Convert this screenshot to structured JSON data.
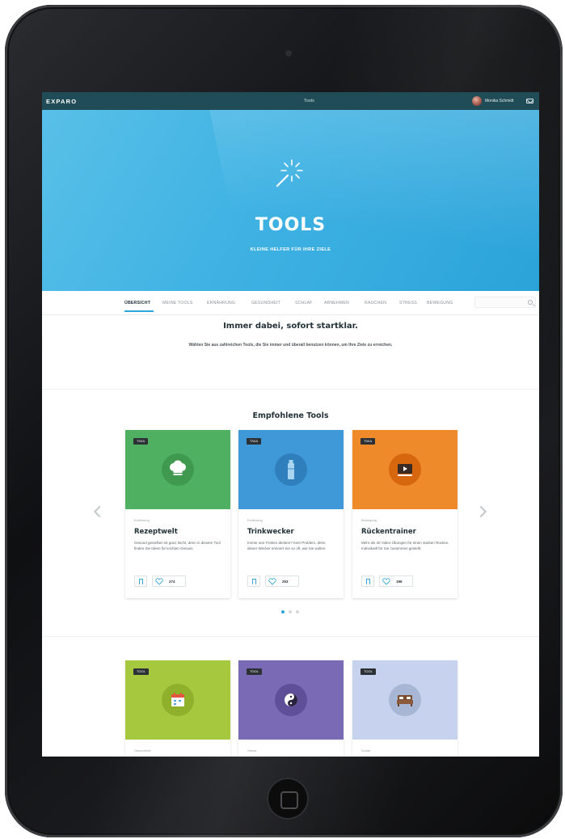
{
  "app": {
    "brand": "EXPARO",
    "page_title": "Tools",
    "user_name": "Monika Schmidt"
  },
  "hero": {
    "title": "TOOLS",
    "subtitle": "KLEINE HELFER FÜR IHRE ZIELE",
    "icon": "magic-wand-icon"
  },
  "nav": {
    "items": [
      {
        "label": "ÜBERSICHT",
        "active": true
      },
      {
        "label": "MEINE TOOLS"
      },
      {
        "label": "ERNÄHRUNG"
      },
      {
        "label": "GESUNDHEIT"
      },
      {
        "label": "SCHLAF"
      },
      {
        "label": "ABNEHMEN"
      },
      {
        "label": "RAUCHEN"
      },
      {
        "label": "STRESS"
      },
      {
        "label": "BEWEGUNG"
      }
    ],
    "search_icon": "search-icon"
  },
  "intro": {
    "title": "Immer dabei, sofort startklar.",
    "text": "Wählen Sie aus zahlreichen Tools, die Sie immer und überall benutzen können, um Ihre Ziele zu erreichen."
  },
  "featured": {
    "title": "Empfohlene Tools",
    "cards": [
      {
        "tag": "TIVIA",
        "category": "Ernährung",
        "title": "Rezeptwelt",
        "description": "Gesund genießen ist ganz leicht, denn in diesem Tool finden Sie Ideen für leichten Genuss.",
        "likes": "274",
        "color": "#4fb061",
        "badge_color": "#3f9a50",
        "icon": "chef-hat-icon"
      },
      {
        "tag": "TIVIA",
        "category": "Ernährung",
        "title": "Trinkwecker",
        "description": "Immer ans Trinken denken? Kein Problem, denn dieser Wecker erinnert Sie so oft, wie Sie wollen.",
        "likes": "253",
        "color": "#3f98d8",
        "badge_color": "#2f7fbc",
        "icon": "water-bottle-icon"
      },
      {
        "tag": "TIVIA",
        "category": "Bewegung",
        "title": "Rückentrainer",
        "description": "Mehr als 40 Video-Übungen für einen starken Rücken. Individuell für Sie zusammen gestellt.",
        "likes": "196",
        "color": "#ee8a2a",
        "badge_color": "#d6670f",
        "icon": "video-player-icon"
      }
    ],
    "pagination": {
      "total": 3,
      "active": 0
    }
  },
  "more_tools": [
    {
      "tag": "TOOL",
      "category": "Gesundheit",
      "color": "#a6c83f",
      "badge_color": "#8eb02b",
      "icon": "calendar-icon"
    },
    {
      "tag": "TOOL",
      "category": "Stress",
      "color": "#7a69b5",
      "badge_color": "#5e4f98",
      "icon": "yin-yang-icon"
    },
    {
      "tag": "TOOL",
      "category": "Schlaf",
      "color": "#c7d3ee",
      "badge_color": "#a8b6d6",
      "icon": "bed-icon"
    }
  ],
  "colors": {
    "topbar": "#1f4c56",
    "hero": "#3fb2e3",
    "accent": "#2aa7dc"
  }
}
